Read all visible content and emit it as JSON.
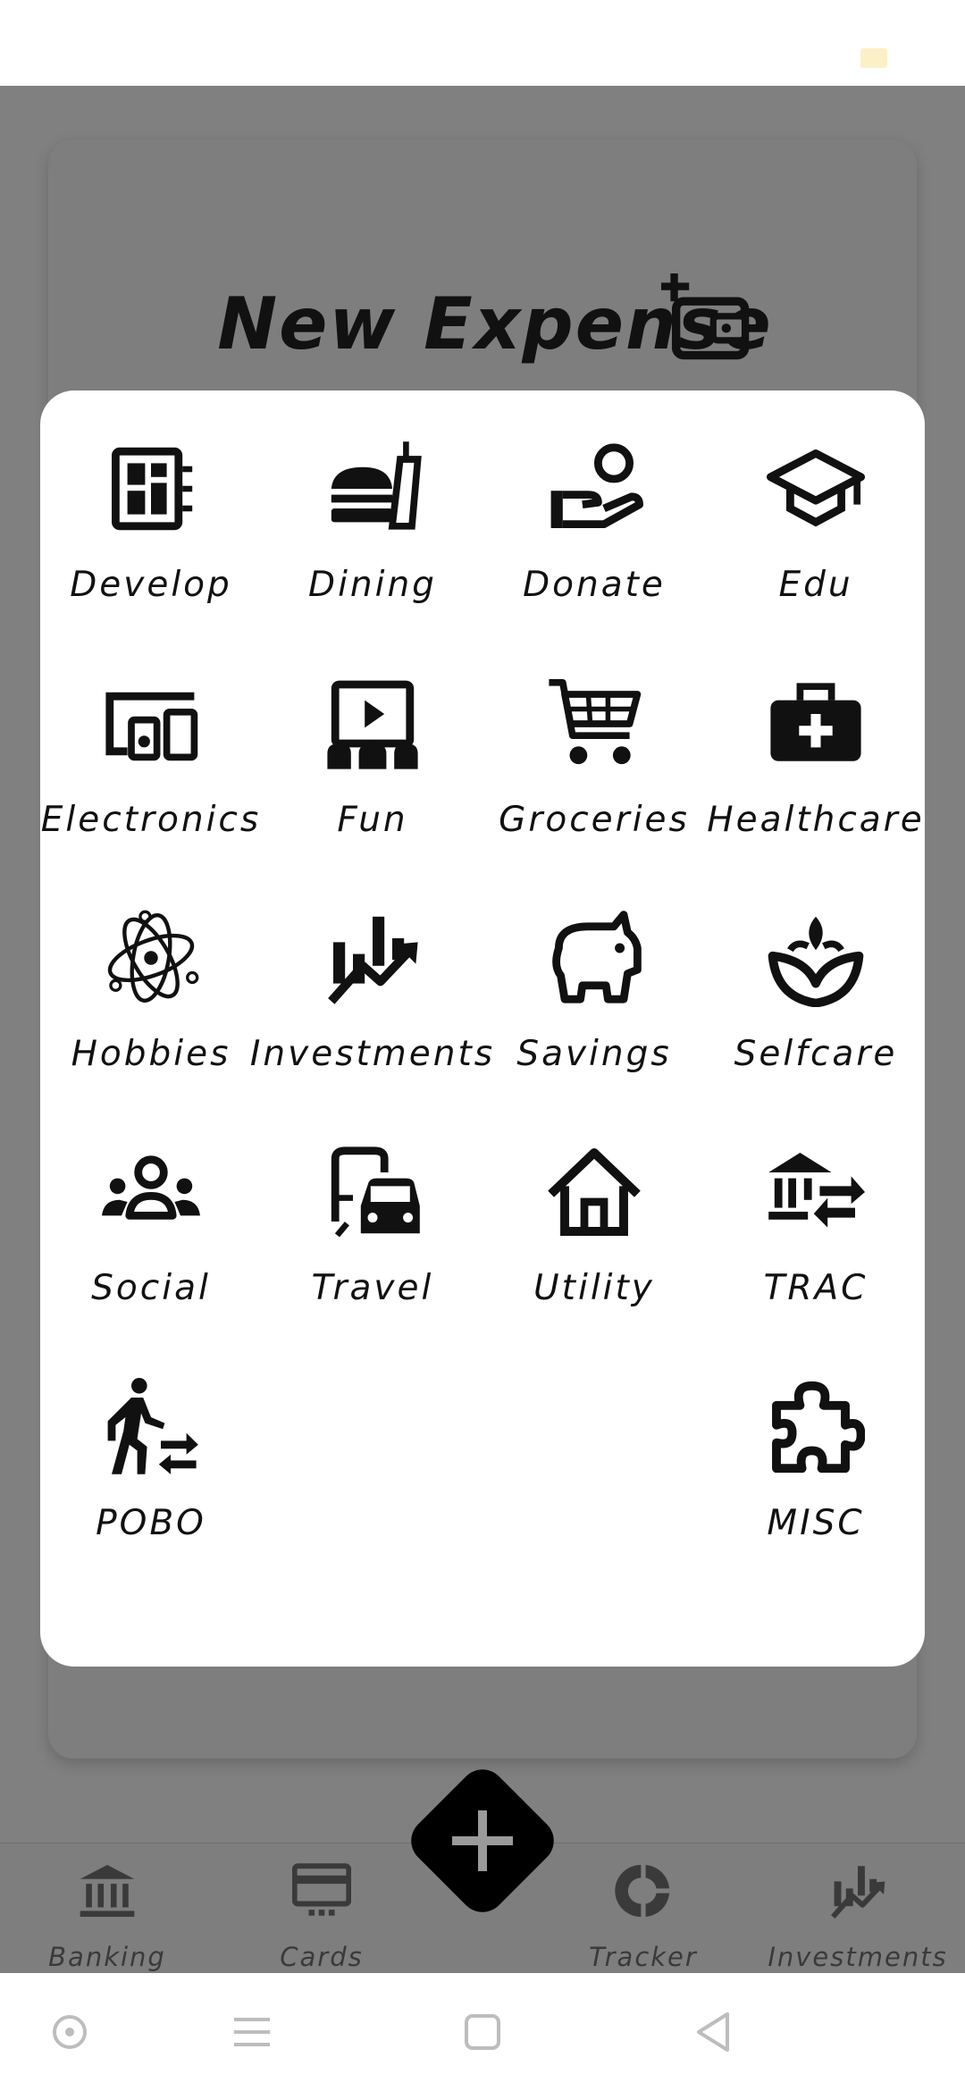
{
  "page": {
    "title": "New Expense"
  },
  "categories": [
    {
      "label": "Develop",
      "icon": "dashboard-icon"
    },
    {
      "label": "Dining",
      "icon": "fastfood-icon"
    },
    {
      "label": "Donate",
      "icon": "donate-hand-icon"
    },
    {
      "label": "Edu",
      "icon": "graduation-cap-icon"
    },
    {
      "label": "Electronics",
      "icon": "devices-icon"
    },
    {
      "label": "Fun",
      "icon": "theater-icon"
    },
    {
      "label": "Groceries",
      "icon": "shopping-cart-icon"
    },
    {
      "label": "Healthcare",
      "icon": "medical-bag-icon"
    },
    {
      "label": "Hobbies",
      "icon": "atom-icon"
    },
    {
      "label": "Investments",
      "icon": "chart-trend-icon"
    },
    {
      "label": "Savings",
      "icon": "piggy-bank-icon"
    },
    {
      "label": "Selfcare",
      "icon": "spa-icon"
    },
    {
      "label": "Social",
      "icon": "group-icon"
    },
    {
      "label": "Travel",
      "icon": "commute-icon"
    },
    {
      "label": "Utility",
      "icon": "house-icon"
    },
    {
      "label": "TRAC",
      "icon": "bank-transfer-icon"
    },
    {
      "label": "POBO",
      "icon": "walking-transfer-icon"
    },
    {
      "label": "MISC",
      "icon": "puzzle-icon"
    }
  ],
  "bottom_nav": [
    {
      "label": "Banking",
      "icon": "bank-icon"
    },
    {
      "label": "Cards",
      "icon": "card-icon"
    },
    {
      "label": "Tracker",
      "icon": "donut-chart-icon"
    },
    {
      "label": "Investments",
      "icon": "chart-trend-icon"
    }
  ],
  "colors": {
    "overlay": "#808080",
    "modal": "#ffffff",
    "fab": "#000000"
  }
}
